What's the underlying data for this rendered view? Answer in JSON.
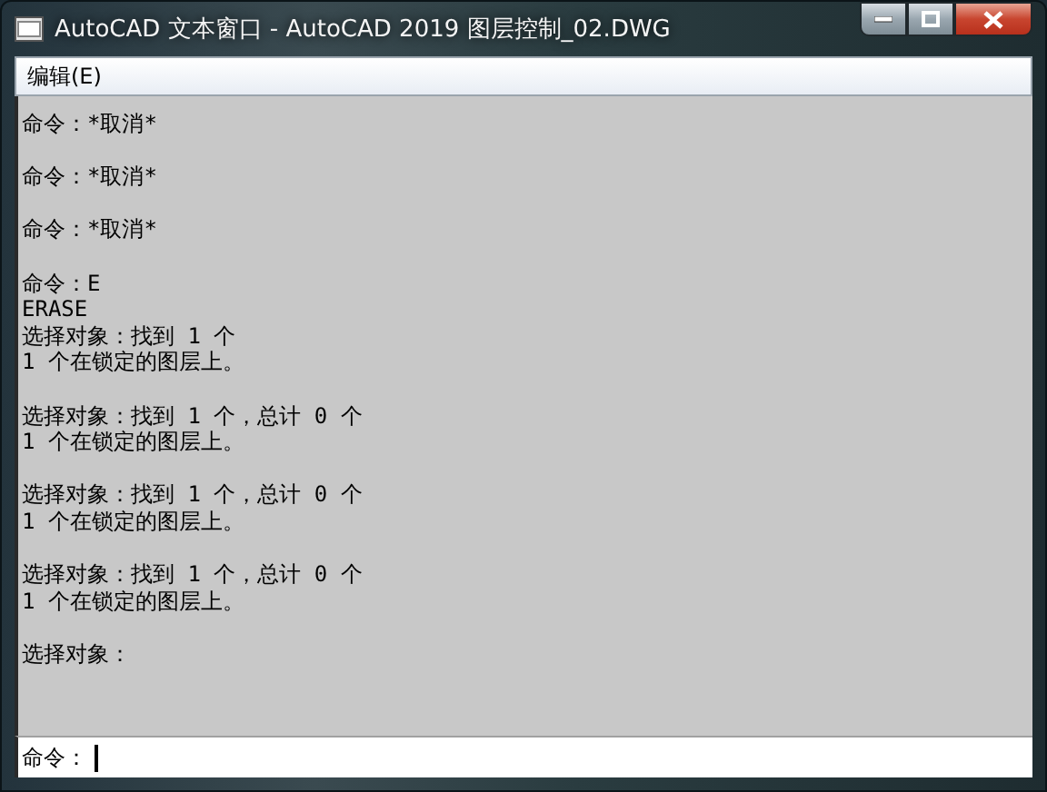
{
  "window": {
    "title": "AutoCAD 文本窗口 - AutoCAD 2019 图层控制_02.DWG"
  },
  "menu": [
    "编辑(E)"
  ],
  "history": [
    {
      "lines": [
        "命令：*取消*"
      ]
    },
    {
      "lines": [
        "命令：*取消*"
      ]
    },
    {
      "lines": [
        "命令：*取消*"
      ]
    },
    {
      "lines": [
        "命令：E",
        "ERASE",
        "选择对象：找到 1 个",
        "1 个在锁定的图层上。"
      ]
    },
    {
      "lines": [
        "选择对象：找到 1 个，总计 0 个",
        "1 个在锁定的图层上。"
      ]
    },
    {
      "lines": [
        "选择对象：找到 1 个，总计 0 个",
        "1 个在锁定的图层上。"
      ]
    },
    {
      "lines": [
        "选择对象：找到 1 个，总计 0 个",
        "1 个在锁定的图层上。"
      ]
    },
    {
      "lines": [
        "选择对象："
      ]
    }
  ],
  "command_line": {
    "prompt": "命令："
  }
}
